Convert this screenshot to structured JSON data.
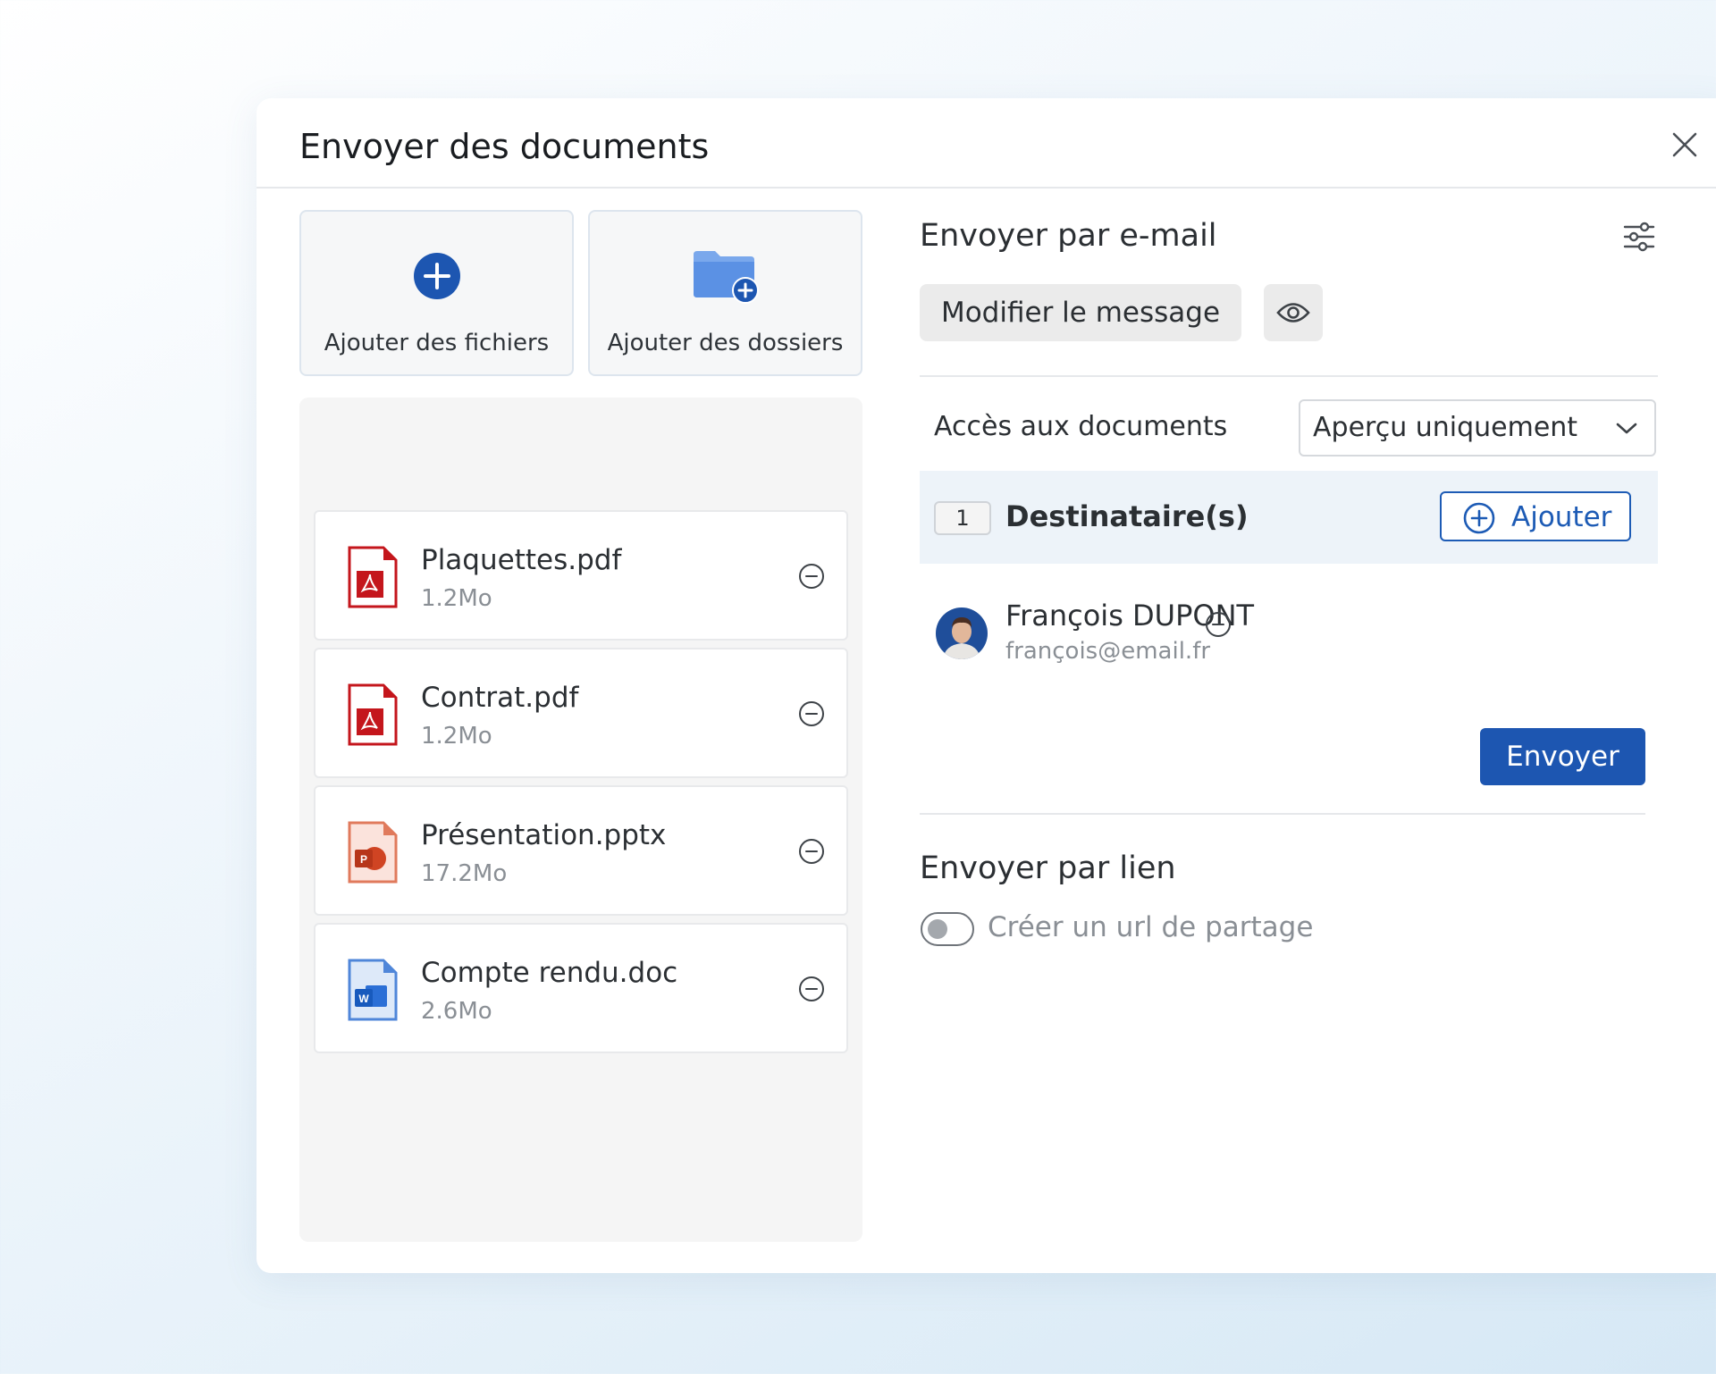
{
  "dialog": {
    "title": "Envoyer des documents"
  },
  "upload": {
    "add_files_label": "Ajouter des fichiers",
    "add_folders_label": "Ajouter des dossiers"
  },
  "files": [
    {
      "name": "Plaquettes.pdf",
      "size": "1.2Mo",
      "type": "pdf-icon"
    },
    {
      "name": "Contrat.pdf",
      "size": "1.2Mo",
      "type": "pdf-icon"
    },
    {
      "name": "Présentation.pptx",
      "size": "17.2Mo",
      "type": "powerpoint-icon"
    },
    {
      "name": "Compte rendu.doc",
      "size": "2.6Mo",
      "type": "word-icon"
    }
  ],
  "email": {
    "title": "Envoyer par e-mail",
    "edit_message_label": "Modifier le message",
    "access_label": "Accès aux documents",
    "access_value": "Aperçu uniquement",
    "recipients_count": "1",
    "recipients_label": "Destinataire(s)",
    "add_label": "Ajouter",
    "recipients": [
      {
        "name": "François DUPONT",
        "email": "françois@email.fr"
      }
    ],
    "send_label": "Envoyer"
  },
  "link": {
    "title": "Envoyer par lien",
    "toggle_label": "Créer un url de partage",
    "toggle_on": false
  },
  "colors": {
    "primary": "#1d56b1",
    "pdf": "#c4161c",
    "powerpoint": "#d04423",
    "word": "#185abd",
    "folder": "#6c9fe8"
  }
}
